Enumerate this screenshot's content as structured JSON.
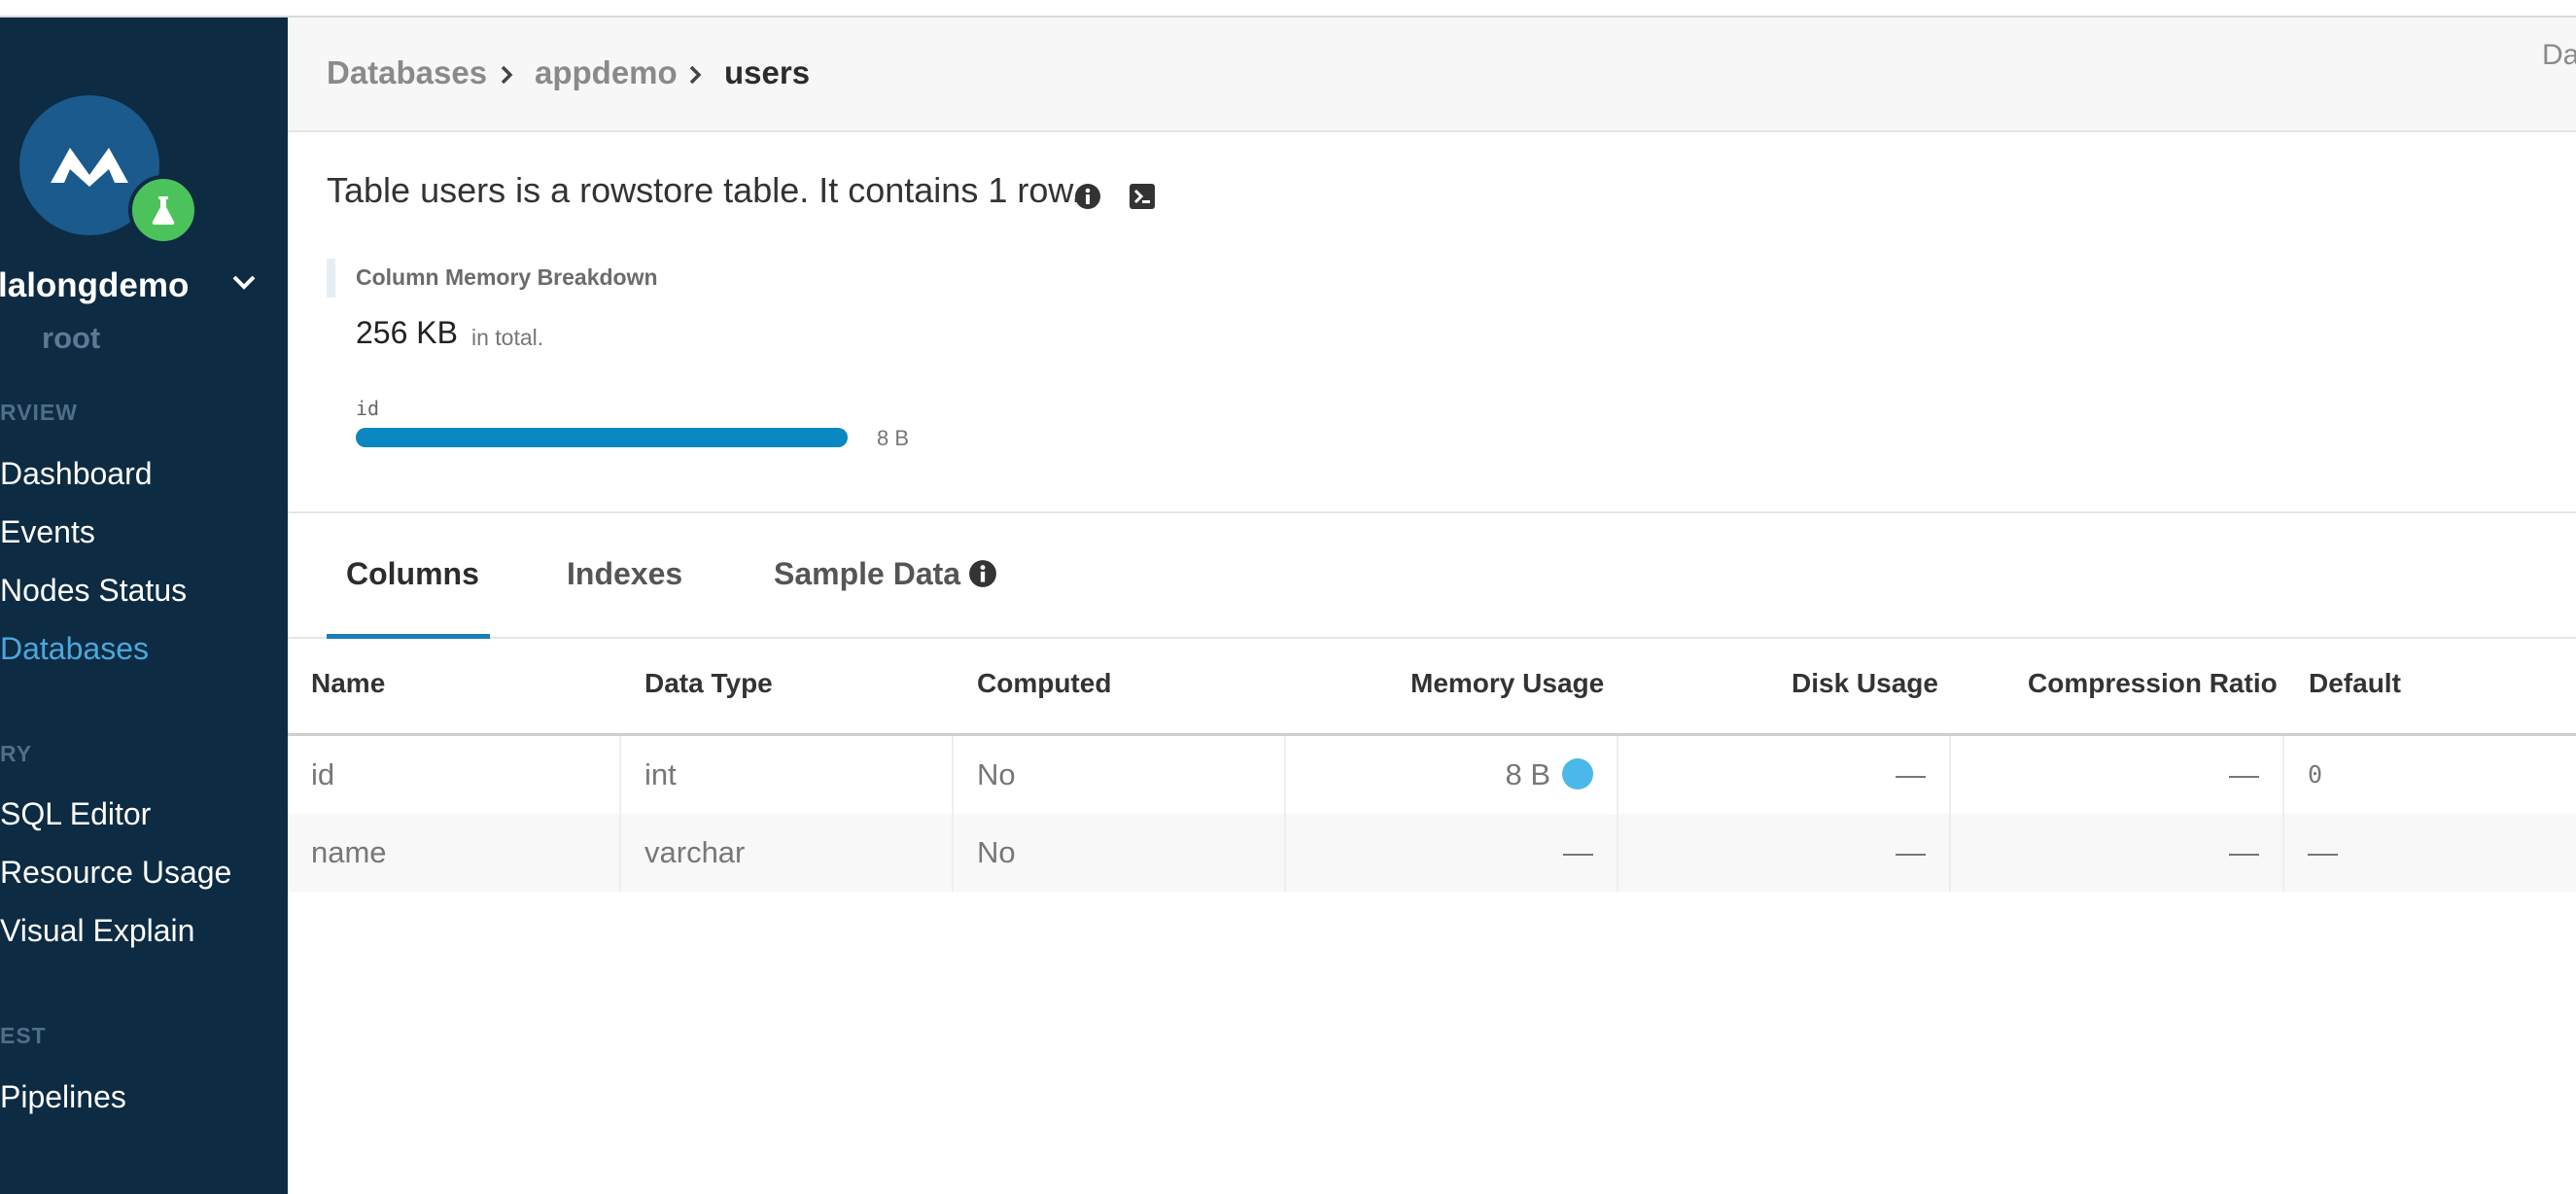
{
  "header": {
    "breadcrumb": [
      "Databases",
      "appdemo",
      "users"
    ],
    "right_text": "Da"
  },
  "sidebar": {
    "cluster_name": "lalongdemo",
    "user": "root",
    "sections": [
      {
        "label": "RVIEW",
        "items": [
          "Dashboard",
          "Events",
          "Nodes Status",
          "Databases"
        ]
      },
      {
        "label": "RY",
        "items": [
          "SQL Editor",
          "Resource Usage",
          "Visual Explain"
        ]
      },
      {
        "label": "EST",
        "items": [
          "Pipelines"
        ]
      }
    ],
    "active_item": "Databases",
    "icons": [
      "memsql-logo-icon",
      "flask-icon",
      "chevron-down-icon"
    ]
  },
  "summary": {
    "text": "Table users is a rowstore table. It contains 1 row.",
    "icons": [
      "info-icon",
      "terminal-icon"
    ]
  },
  "breakdown": {
    "title": "Column Memory Breakdown",
    "total": "256 KB",
    "total_suffix": "in total.",
    "bars": [
      {
        "column": "id",
        "value": "8 B",
        "fraction": 1.0
      }
    ]
  },
  "tabs": [
    "Columns",
    "Indexes",
    "Sample Data"
  ],
  "active_tab": "Columns",
  "table": {
    "headers": [
      "Name",
      "Data Type",
      "Computed",
      "Memory Usage",
      "Disk Usage",
      "Compression Ratio",
      "Default"
    ],
    "rows": [
      [
        "id",
        "int",
        "No",
        "8 B",
        "—",
        "—",
        "0"
      ],
      [
        "name",
        "varchar",
        "No",
        "—",
        "—",
        "—",
        "—"
      ]
    ]
  },
  "colors": {
    "sidebar_bg": "#0d2b42",
    "accent": "#1a7fb8",
    "active_nav": "#4aa8dc",
    "memory_bar": "#0a86c0",
    "memory_dot": "#4ab8e8",
    "badge_green": "#4cc35a"
  }
}
